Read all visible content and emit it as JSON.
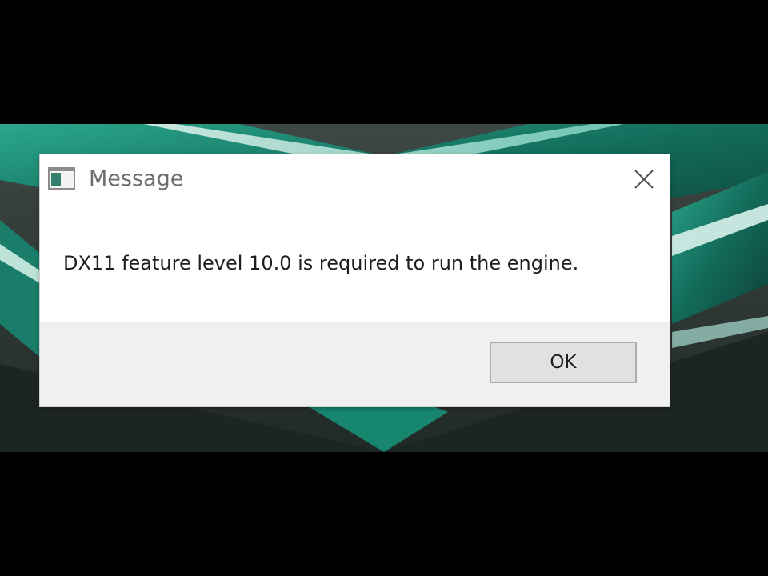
{
  "dialog": {
    "title": "Message",
    "message": "DX11 feature level 10.0 is required to run the engine.",
    "ok_label": "OK",
    "close_icon": "close-icon",
    "app_icon": "window-icon"
  },
  "colors": {
    "wallpaper_teal": "#1f8c78",
    "wallpaper_dark": "#2f3a36",
    "dialog_bg": "#ffffff",
    "footer_bg": "#f0f0f0",
    "button_bg": "#e1e1e1",
    "button_border": "#adadad"
  }
}
